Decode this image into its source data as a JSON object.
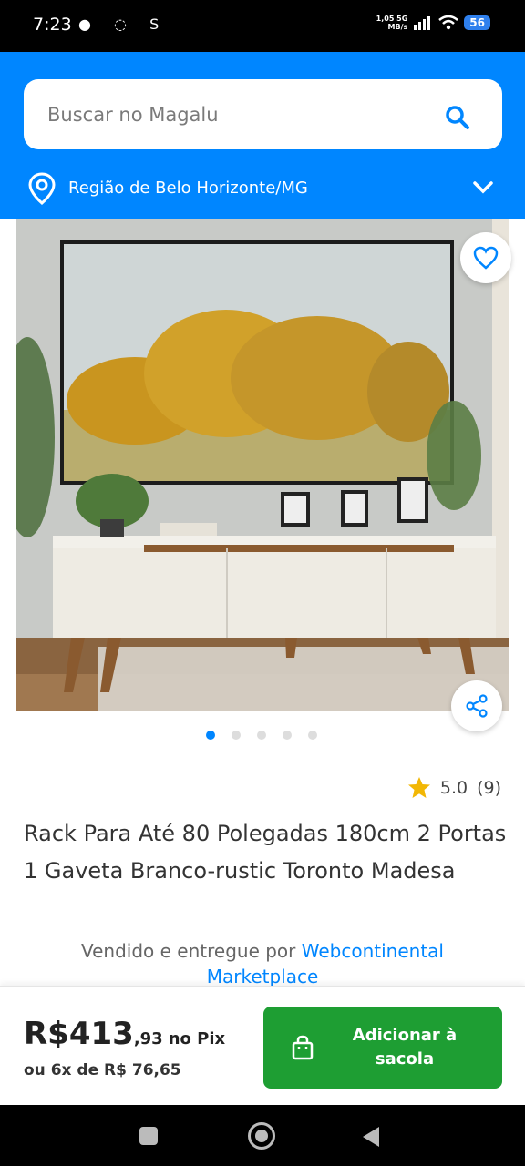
{
  "status_bar": {
    "time": "7:23",
    "icons": "● ◌ S",
    "net_speed_top": "1,05 5G",
    "net_speed_bottom": "MB/s",
    "battery": "56"
  },
  "search": {
    "placeholder": "Buscar no Magalu"
  },
  "region": {
    "label": "Região de Belo Horizonte/MG"
  },
  "gallery": {
    "image_count": 5,
    "active_index": 0
  },
  "product": {
    "rating": "5.0",
    "review_count": "(9)",
    "title": "Rack Para Até 80 Polegadas 180cm 2 Portas 1 Gaveta Branco-rustic Toronto Madesa",
    "seller_prefix": "Vendido e entregue por",
    "seller_name": "Webcontinental Marketplace"
  },
  "purchase": {
    "price_main": "R$413",
    "price_cents": ",93",
    "price_method": "no Pix",
    "installments": "ou 6x de R$ 76,65",
    "add_button": "Adicionar à sacola"
  },
  "colors": {
    "brand_blue": "#0086ff",
    "add_green": "#1e9e33"
  }
}
